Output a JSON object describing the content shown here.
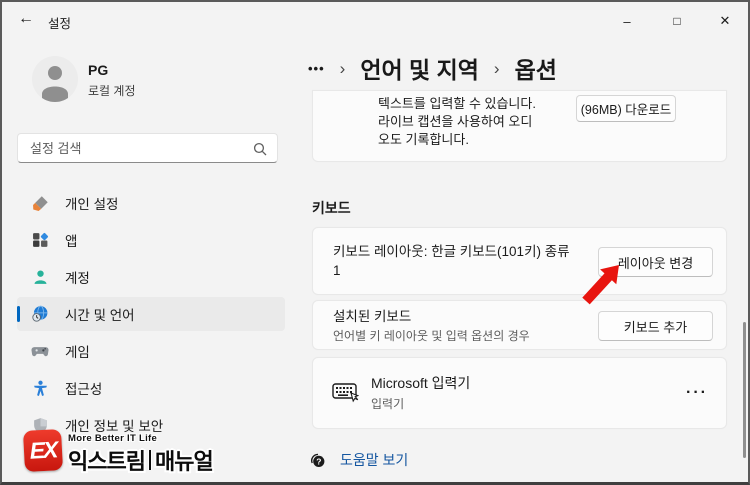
{
  "window": {
    "title": "설정",
    "back_icon": "←",
    "minimize_icon": "–",
    "maximize_icon": "□",
    "close_icon": "✕"
  },
  "sidebar": {
    "profile": {
      "name": "PG",
      "account_type": "로컬 계정"
    },
    "search": {
      "placeholder": "설정 검색"
    },
    "items": [
      {
        "label": "개인 설정",
        "icon": "personalization-brush-icon",
        "selected": false
      },
      {
        "label": "앱",
        "icon": "apps-icon",
        "selected": false
      },
      {
        "label": "계정",
        "icon": "accounts-icon",
        "selected": false
      },
      {
        "label": "시간 및 언어",
        "icon": "time-language-icon",
        "selected": true
      },
      {
        "label": "게임",
        "icon": "gamepad-icon",
        "selected": false
      },
      {
        "label": "접근성",
        "icon": "accessibility-icon",
        "selected": false
      },
      {
        "label": "개인 정보 및 보안",
        "icon": "privacy-shield-icon",
        "selected": false
      }
    ]
  },
  "breadcrumb": {
    "overflow": "•••",
    "separator": "›",
    "crumbs": [
      "언어 및 지역",
      "옵션"
    ]
  },
  "content": {
    "speech_card": {
      "line1": "텍스트를 입력할 수 있습니다.",
      "line2": "라이브 캡션을 사용하여 오디",
      "line3": "오도 기록합니다.",
      "download_button": "(96MB) 다운로드"
    },
    "keyboard_section": {
      "title": "키보드",
      "layout_card": {
        "label_line1": "키보드 레이아웃: 한글 키보드(101키) 종류",
        "label_line2": "1",
        "button": "레이아웃 변경"
      },
      "installed_card": {
        "title": "설치된 키보드",
        "subtitle": "언어별 키 레이아웃 및 입력 옵션의 경우",
        "button": "키보드 추가"
      },
      "ime_card": {
        "title": "Microsoft 입력기",
        "subtitle": "입력기",
        "more": "···"
      }
    },
    "help": {
      "label": "도움말 보기"
    }
  },
  "watermark": {
    "logo_text": "EX",
    "tagline": "More Better IT Life",
    "brand_first": "익스트림",
    "brand_second": "매뉴얼"
  },
  "colors": {
    "accent": "#0067c0",
    "link_blue": "#1456a0",
    "arrow_red": "#e8150f",
    "logo_red": "#d8201a",
    "window_bg": "#f3f3f3",
    "card_bg": "#fbfbfb"
  }
}
